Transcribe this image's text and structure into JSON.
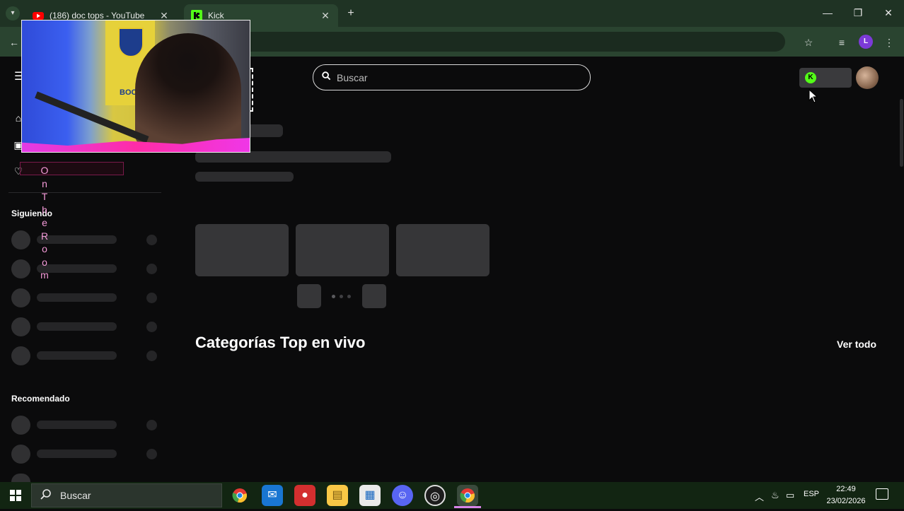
{
  "browser": {
    "tabs": [
      {
        "label": "(186) doc tops - YouTube",
        "favicon": "youtube-icon"
      },
      {
        "label": "Kick",
        "favicon": "kick-icon",
        "active": true
      }
    ],
    "profile_initial": "L"
  },
  "page": {
    "search_placeholder": "Buscar",
    "sidebar": {
      "following_heading": "Siguiendo",
      "recommended_heading": "Recomendado"
    },
    "section_title": "Categorías Top en vivo",
    "view_all": "Ver todo"
  },
  "overlay": {
    "name": "OnTheRoom"
  },
  "taskbar": {
    "search_label": "Buscar",
    "language": "ESP",
    "time": "22:49",
    "date": "23/02/2026"
  },
  "colors": {
    "kick_green": "#53fc18",
    "tab_strip": "#1f3324",
    "toolbar": "#2a4430",
    "page_bg": "#0b0b0c",
    "overlay_pink": "#f49ad8"
  }
}
